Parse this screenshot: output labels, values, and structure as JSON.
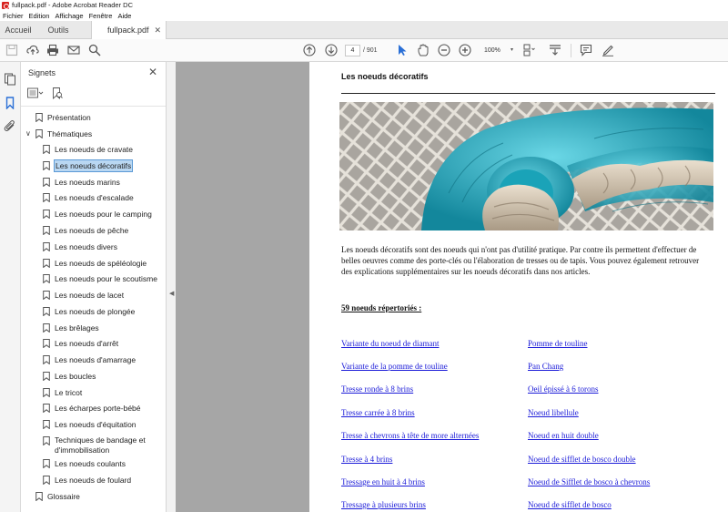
{
  "window": {
    "title": "fullpack.pdf - Adobe Acrobat Reader DC"
  },
  "menu": [
    "Fichier",
    "Edition",
    "Affichage",
    "Fenêtre",
    "Aide"
  ],
  "tabs": {
    "home": "Accueil",
    "tools": "Outils",
    "document": "fullpack.pdf"
  },
  "toolbar": {
    "page_current": "4",
    "page_total": "/ 901",
    "zoom": "100%"
  },
  "panel": {
    "title": "Signets"
  },
  "bookmarks": {
    "presentation": "Présentation",
    "thematiques": "Thématiques",
    "children": [
      "Les noeuds de cravate",
      "Les noeuds décoratifs",
      "Les noeuds marins",
      "Les noeuds d'escalade",
      "Les noeuds pour le camping",
      "Les noeuds de pêche",
      "Les noeuds divers",
      "Les noeuds de spéléologie",
      "Les noeuds pour le scoutisme",
      "Les noeuds de lacet",
      "Les noeuds de plongée",
      "Les brêlages",
      "Les noeuds d'arrêt",
      "Les noeuds d'amarrage",
      "Les boucles",
      "Le tricot",
      "Les écharpes porte-bébé",
      "Les noeuds d'équitation",
      "Techniques de bandage et d'immobilisation",
      "Les noeuds coulants",
      "Les noeuds de foulard"
    ],
    "selected_index": 1,
    "glossaire": "Glossaire"
  },
  "document": {
    "title": "Les noeuds décoratifs",
    "intro": "Les noeuds décoratifs sont des noeuds qui n'ont pas d'utilité pratique. Par contre ils permettent d'effectuer de belles oeuvres comme des porte-clés ou l'élaboration de tresses ou de tapis. Vous pouvez également retrouver des explications supplémentaires sur les noeuds décoratifs dans nos articles.",
    "count_label": "59 noeuds répertoriés :",
    "links_left": [
      "Variante du noeud de diamant",
      "Variante de la pomme de touline",
      "Tresse ronde à 8 brins ",
      "Tresse carrée à 8 brins",
      "Tresse à chevrons à tête de more alternées",
      "Tresse à 4 brins",
      "Tressage en huit à 4 brins",
      "Tressage à plusieurs brins"
    ],
    "links_right": [
      "Pomme de touline",
      "Pan Chang",
      "Oeil épissé à 6 torons",
      "Noeud libellule",
      "Noeud en huit double",
      "Noeud de sifflet de bosco double",
      "Noeud de Sifflet de bosco à chevrons",
      "Noeud de sifflet de bosco"
    ]
  },
  "colors": {
    "accent": "#2a6fd6",
    "link": "#1a1ad8",
    "selection": "#b9d7f2",
    "acrobat_red": "#d8231f"
  }
}
